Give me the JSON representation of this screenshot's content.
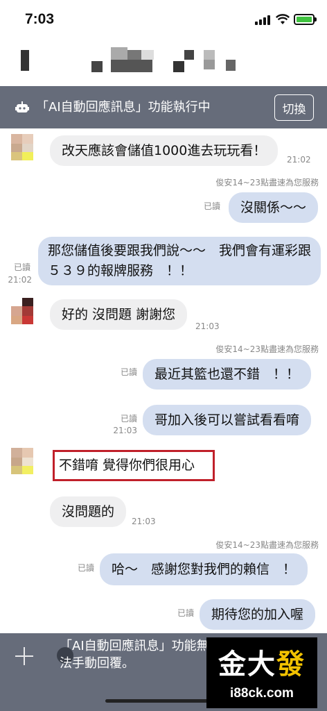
{
  "status_bar": {
    "time": "7:03"
  },
  "ai_banner": {
    "text": "「AI自動回應訊息」功能執行中",
    "switch_label": "切換"
  },
  "service_note": "俊安14~23點盡速為您服務",
  "messages": [
    {
      "side": "in",
      "text": "改天應該會儲值1000進去玩玩看！",
      "time": "21:02"
    },
    {
      "side": "out",
      "text": "沒關係～～",
      "read": "已讀"
    },
    {
      "side": "out",
      "text": "那您儲值後要跟我們說～～　我們會有運彩跟５３９的報牌服務　！！",
      "read": "已讀",
      "time": "21:02"
    },
    {
      "side": "in",
      "text": "好的 沒問題 謝謝您",
      "time": "21:03"
    },
    {
      "side": "out",
      "text": "最近其籃也還不錯　！！",
      "read": "已讀"
    },
    {
      "side": "out",
      "text": "哥加入後可以嘗試看看唷",
      "read": "已讀",
      "time": "21:03"
    },
    {
      "side": "in",
      "text": "不錯唷 覺得你們很用心",
      "highlighted": true
    },
    {
      "side": "in",
      "text": "沒問題的",
      "time": "21:03"
    },
    {
      "side": "out",
      "text": "哈～　感謝您對我們的賴信　！",
      "read": "已讀"
    },
    {
      "side": "out",
      "text": "期待您的加入喔",
      "read": "已讀"
    }
  ],
  "input_bar": {
    "notice": "「AI自動回應訊息」功能無法手動回覆。"
  },
  "watermark": {
    "logo_a": "金大",
    "logo_b": "發",
    "site": "i88ck.com"
  },
  "colors": {
    "banner": "#666c7a",
    "bubble_out": "#d4def0",
    "bubble_in": "#efeff0",
    "highlight": "#c0202a",
    "watermark_gold": "#f2c200"
  }
}
